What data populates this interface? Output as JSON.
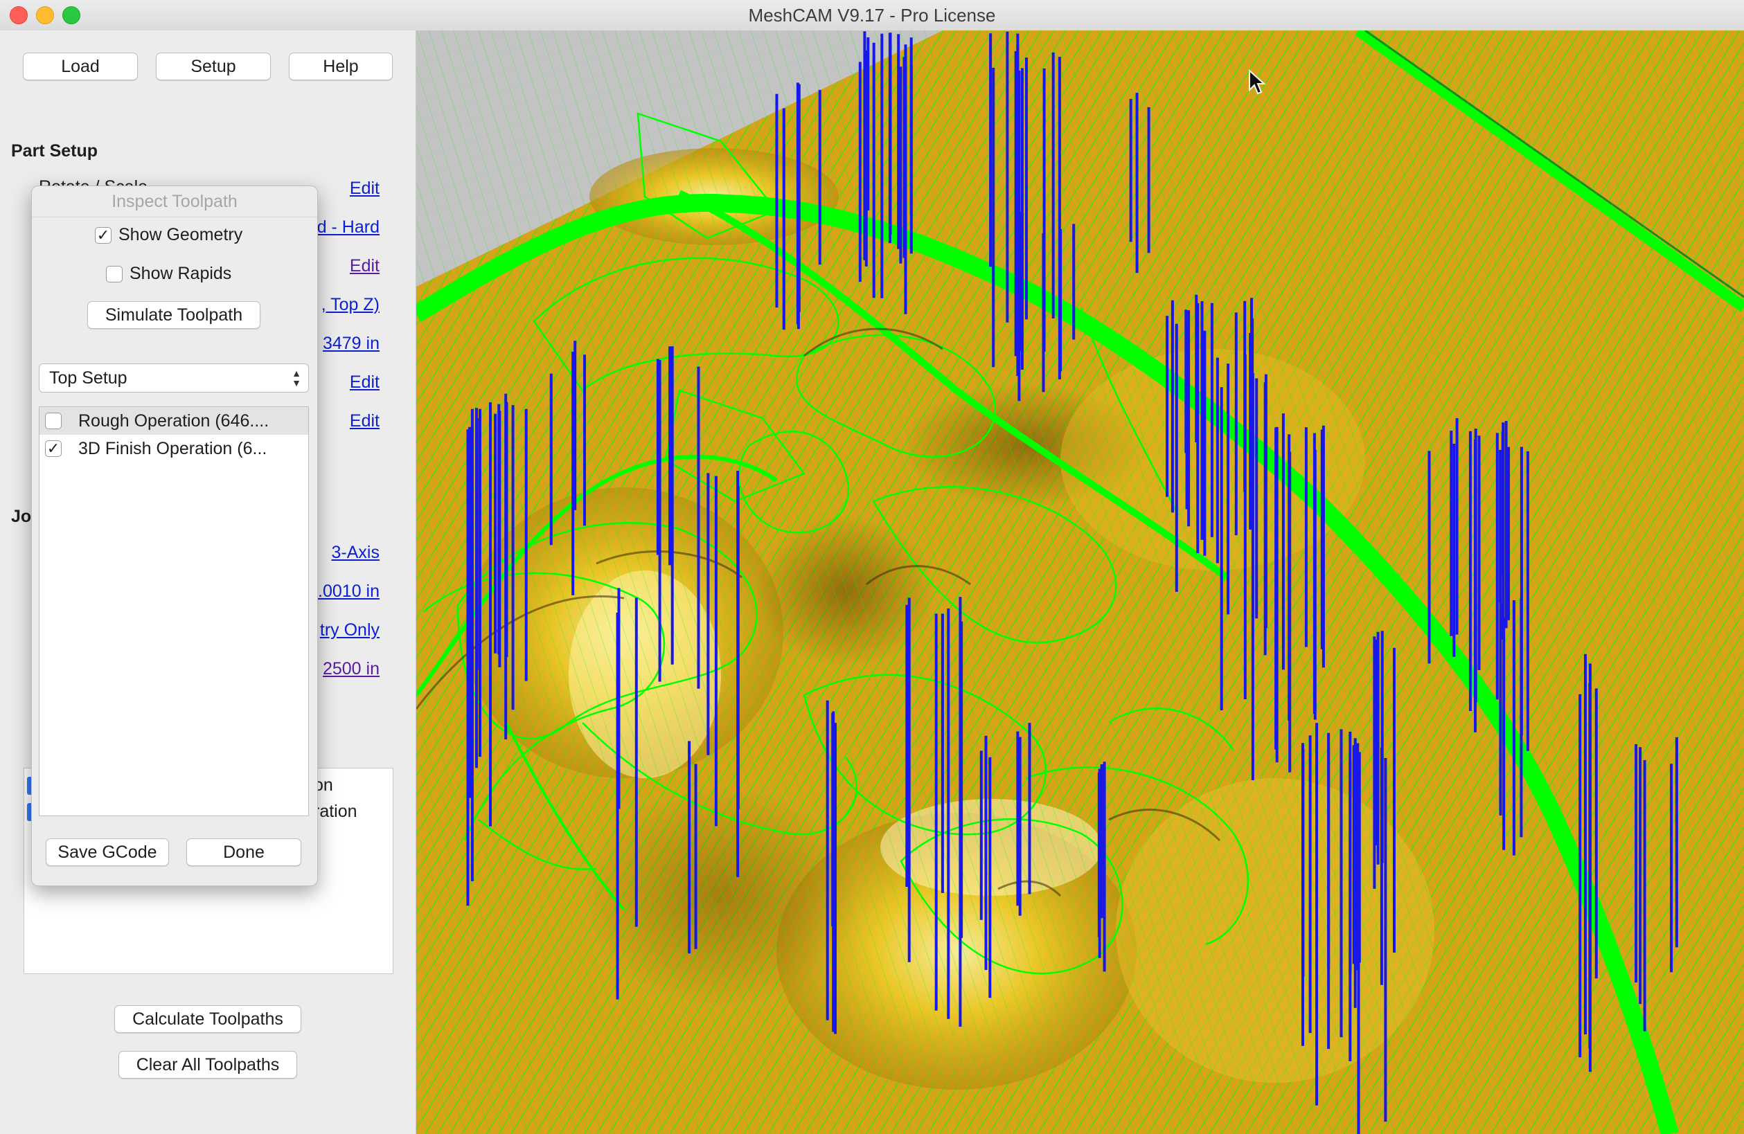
{
  "window": {
    "title": "MeshCAM V9.17 - Pro License"
  },
  "toolbar": {
    "load": "Load",
    "setup": "Setup",
    "help": "Help"
  },
  "part_setup": {
    "heading": "Part Setup",
    "rotate_label_partial": "Rotate / Scale",
    "links": [
      "Edit",
      "d - Hard",
      "Edit",
      ", Top Z)",
      "3479 in",
      "Edit",
      "Edit"
    ]
  },
  "job": {
    "heading_partial": "Jo",
    "links": [
      "3-Axis",
      ".0010 in",
      "try Only",
      "2500 in"
    ]
  },
  "ops_list_partial": [
    "on",
    "ration"
  ],
  "actions": {
    "calculate": "Calculate Toolpaths",
    "clear": "Clear All Toolpaths"
  },
  "dialog": {
    "title": "Inspect Toolpath",
    "show_geometry": {
      "label": "Show Geometry",
      "checked": true
    },
    "show_rapids": {
      "label": "Show Rapids",
      "checked": false
    },
    "simulate": "Simulate Toolpath",
    "setup_select": "Top Setup",
    "operations": [
      {
        "label": "Rough Operation (646....",
        "checked": false,
        "selected": true
      },
      {
        "label": "3D Finish Operation (6...",
        "checked": true,
        "selected": false
      }
    ],
    "save": "Save GCode",
    "done": "Done"
  },
  "colors": {
    "toolpath": "#00ff00",
    "rapid": "#1010ff",
    "surface": "#d4a418",
    "link": "#0a1fd6"
  },
  "icons": {
    "cursor": "arrow-cursor-icon",
    "select_arrows": "chevron-updown-icon"
  }
}
